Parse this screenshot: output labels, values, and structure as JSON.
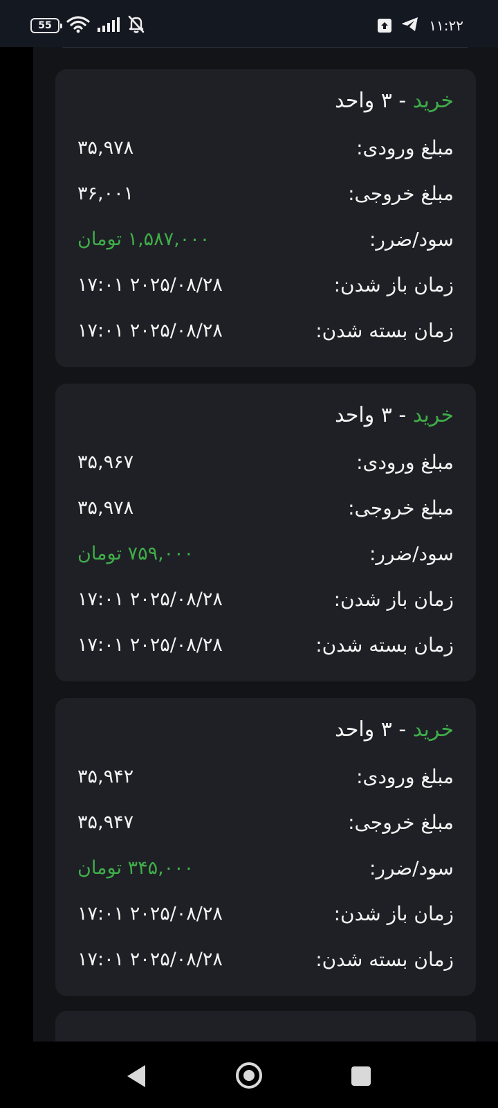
{
  "status_bar": {
    "battery_level": "55",
    "time": "۱۱:۲۲",
    "icons": [
      "battery-icon",
      "wifi-icon",
      "signal-icon",
      "notifications-off-icon",
      "upload-icon",
      "telegram-icon"
    ]
  },
  "labels": {
    "entry": "مبلغ ورودی:",
    "exit": "مبلغ خروجی:",
    "pnl": "سود/ضرر:",
    "open_time": "زمان باز شدن:",
    "close_time": "زمان بسته شدن:"
  },
  "colors": {
    "profit": "#3fae4a",
    "card_bg": "#1f2025",
    "panel_bg": "#131418"
  },
  "trades": [
    {
      "side": "خرید",
      "quantity": "- ۳ واحد",
      "entry": "۳۵,۹۷۸",
      "exit": "۳۶,۰۰۱",
      "pnl": "۱,۵۸۷,۰۰۰ تومان",
      "open_time": "۲۰۲۵/۰۸/۲۸ ۱۷:۰۱",
      "close_time": "۲۰۲۵/۰۸/۲۸ ۱۷:۰۱"
    },
    {
      "side": "خرید",
      "quantity": "- ۳ واحد",
      "entry": "۳۵,۹۶۷",
      "exit": "۳۵,۹۷۸",
      "pnl": "۷۵۹,۰۰۰ تومان",
      "open_time": "۲۰۲۵/۰۸/۲۸ ۱۷:۰۱",
      "close_time": "۲۰۲۵/۰۸/۲۸ ۱۷:۰۱"
    },
    {
      "side": "خرید",
      "quantity": "- ۳ واحد",
      "entry": "۳۵,۹۴۲",
      "exit": "۳۵,۹۴۷",
      "pnl": "۳۴۵,۰۰۰ تومان",
      "open_time": "۲۰۲۵/۰۸/۲۸ ۱۷:۰۱",
      "close_time": "۲۰۲۵/۰۸/۲۸ ۱۷:۰۱"
    }
  ]
}
